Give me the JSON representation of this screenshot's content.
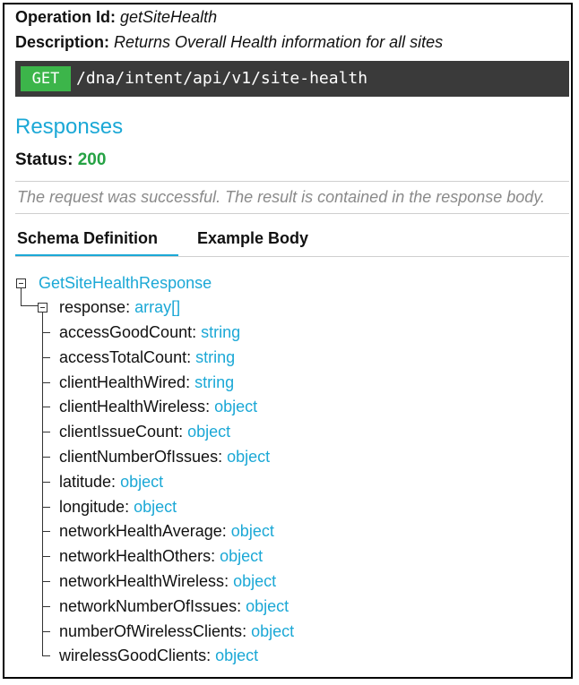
{
  "operation": {
    "id_label": "Operation Id:",
    "id_value": "getSiteHealth",
    "desc_label": "Description:",
    "desc_value": "Returns Overall Health information for all sites"
  },
  "endpoint": {
    "method": "GET",
    "path": "/dna/intent/api/v1/site-health",
    "method_color": "#3cb54a"
  },
  "responses": {
    "title": "Responses",
    "status_label": "Status:",
    "status_code": "200",
    "description": "The request was successful. The result is contained in the response body."
  },
  "tabs": [
    {
      "label": "Schema Definition",
      "active": true
    },
    {
      "label": "Example Body",
      "active": false
    }
  ],
  "schema": {
    "root": "GetSiteHealthResponse",
    "response": {
      "name": "response",
      "type": "array[]"
    },
    "fields": [
      {
        "name": "accessGoodCount",
        "type": "string"
      },
      {
        "name": "accessTotalCount",
        "type": "string"
      },
      {
        "name": "clientHealthWired",
        "type": "string"
      },
      {
        "name": "clientHealthWireless",
        "type": "object"
      },
      {
        "name": "clientIssueCount",
        "type": "object"
      },
      {
        "name": "clientNumberOfIssues",
        "type": "object"
      },
      {
        "name": "latitude",
        "type": "object"
      },
      {
        "name": "longitude",
        "type": "object"
      },
      {
        "name": "networkHealthAverage",
        "type": "object"
      },
      {
        "name": "networkHealthOthers",
        "type": "object"
      },
      {
        "name": "networkHealthWireless",
        "type": "object"
      },
      {
        "name": "networkNumberOfIssues",
        "type": "object"
      },
      {
        "name": "numberOfWirelessClients",
        "type": "object"
      },
      {
        "name": "wirelessGoodClients",
        "type": "object"
      }
    ]
  },
  "colors": {
    "link": "#1ba8d6",
    "status_ok": "#25a244",
    "endpoint_bg": "#3a3a3a"
  }
}
